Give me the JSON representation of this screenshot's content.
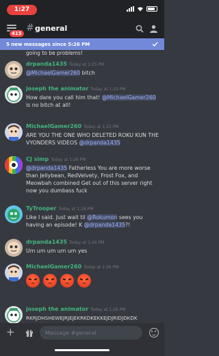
{
  "status_bar": {
    "time": "1:27"
  },
  "header": {
    "badge_count": "415",
    "hash": "#",
    "channel": "general"
  },
  "banner": {
    "text": "5 new messages since 5:26 PM"
  },
  "feed": {
    "cut_text": "going to be problems!",
    "messages": [
      {
        "username": "drpanda1435",
        "color": "#43b581",
        "timestamp": "Today at 1:25 PM",
        "parts": [
          {
            "t": "@MichaelGamer260",
            "m": true
          },
          {
            "t": " bitch",
            "m": false
          }
        ]
      },
      {
        "username": "joseph the animator",
        "color": "#43b581",
        "timestamp": "Today at 1:25 PM",
        "parts": [
          {
            "t": "How dare you call him that! ",
            "m": false
          },
          {
            "t": "@MichaelGamer260",
            "m": true
          },
          {
            "t": " is no bitch at all!",
            "m": false
          }
        ]
      },
      {
        "username": "MichaelGamer260",
        "color": "#43b581",
        "timestamp": "Today at 1:25 PM",
        "parts": [
          {
            "t": "ARE YOU THE ONE WHO DELETED ROKU KUN THE VYONDERS VIDEOS ",
            "m": false
          },
          {
            "t": "@drpanda1435",
            "m": true
          }
        ]
      },
      {
        "username": "CJ simp",
        "color": "#43b581",
        "timestamp": "Today at 1:26 PM",
        "parts": [
          {
            "t": "@drpanda1435",
            "m": true
          },
          {
            "t": " Fatherless You are more worse than Jellybean, RedVelvety, Frost Fox, and Meowbah combined Get out of this server right now you dumbass fuck",
            "m": false
          }
        ]
      },
      {
        "username": "TyTrooper",
        "color": "#43b581",
        "timestamp": "Today at 1:26 PM",
        "parts": [
          {
            "t": "Like I said. Just wait til ",
            "m": false
          },
          {
            "t": "@Rokumon",
            "m": true
          },
          {
            "t": " sees you having an episode! K ",
            "m": false
          },
          {
            "t": "@drpanda1435",
            "m": true
          },
          {
            "t": "?!",
            "m": false
          }
        ]
      },
      {
        "username": "drpanda1435",
        "color": "#43b581",
        "timestamp": "Today at 1:26 PM",
        "parts": [
          {
            "t": "Um um um um um yes",
            "m": false
          }
        ]
      },
      {
        "username": "MichaelGamer260",
        "color": "#43b581",
        "timestamp": "Today at 1:26 PM",
        "emoji": [
          "angry-face",
          "angry-face",
          "angry-face",
          "angry-face"
        ]
      },
      {
        "username": "joseph the animator",
        "color": "#43b581",
        "timestamp": "Today at 1:26 PM",
        "parts": [
          {
            "t": "RKRJDHSHEWEJRJEJEKRKDKEKKEJDJRIDJDKDK",
            "m": false
          }
        ]
      }
    ]
  },
  "composer": {
    "placeholder": "Message #general"
  },
  "colors": {
    "background": "#36393f",
    "header": "#202225",
    "blurple": "#7289da",
    "username_green": "#43b581",
    "badge_red": "#f04747"
  },
  "icons": [
    "menu-icon",
    "search-icon",
    "members-icon",
    "plus-icon",
    "gift-icon",
    "emoji-icon"
  ]
}
